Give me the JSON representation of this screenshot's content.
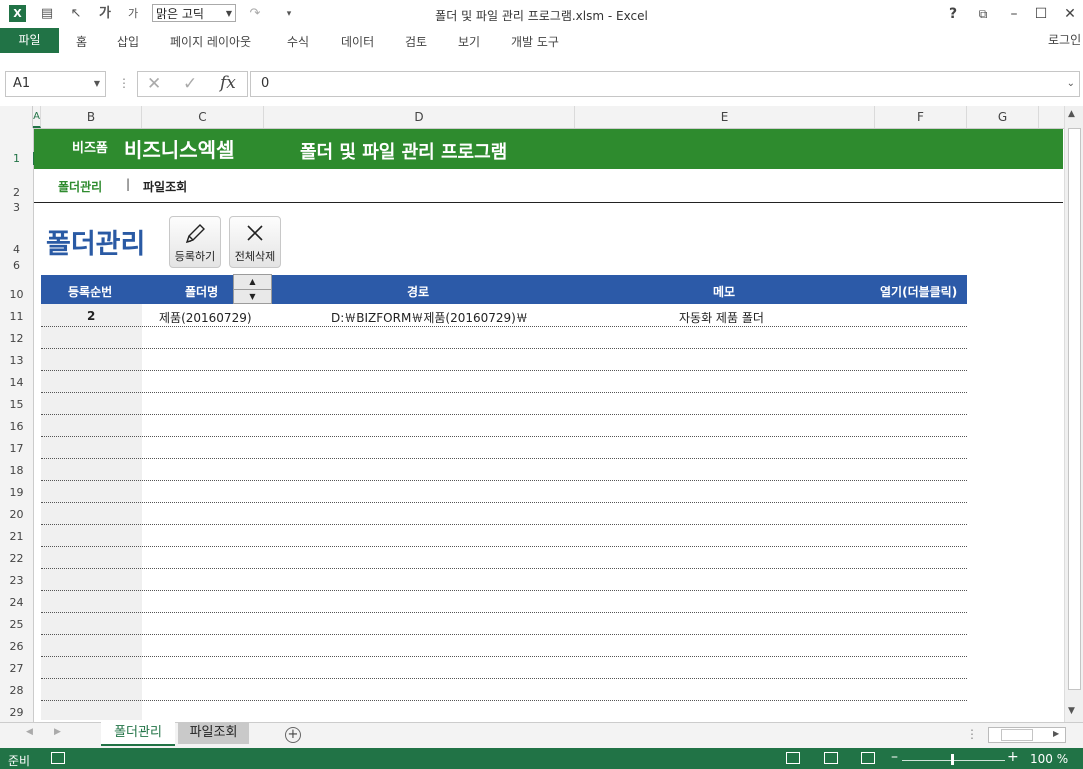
{
  "window": {
    "title": "폴더 및 파일 관리 프로그램.xlsm - Excel",
    "font_name": "맑은 고딕",
    "login": "로그인",
    "help": "?"
  },
  "ribbon": {
    "file": "파일",
    "tabs": [
      "홈",
      "삽입",
      "페이지 레이아웃",
      "수식",
      "데이터",
      "검토",
      "보기",
      "개발 도구"
    ]
  },
  "formula_bar": {
    "name_box": "A1",
    "fx": "fx",
    "value": "0"
  },
  "columns": [
    "A",
    "B",
    "C",
    "D",
    "E",
    "F",
    "G"
  ],
  "rows": [
    "1",
    "2",
    "3",
    "4",
    "6",
    "10",
    "11",
    "12",
    "13",
    "14",
    "15",
    "16",
    "17",
    "18",
    "19",
    "20",
    "21",
    "22",
    "23",
    "24",
    "25",
    "26",
    "27",
    "28",
    "29"
  ],
  "sheet": {
    "brand_small": "비즈폼",
    "brand_big": "비즈니스엑셀",
    "program_title": "폴더 및  파일 관리 프로그램",
    "nav": {
      "folder": "폴더관리",
      "separator": "|",
      "file": "파일조회"
    },
    "heading": "폴더관리",
    "buttons": {
      "register": "등록하기",
      "delete_all": "전체삭제"
    },
    "table": {
      "headers": [
        "등록순번",
        "폴더명",
        "경로",
        "메모",
        "열기(더블클릭)"
      ],
      "rows": [
        {
          "num": "2",
          "name": "제품(20160729)",
          "path": "D:￦BIZFORM￦제품(20160729)￦",
          "memo": "자동화 제품 폴더"
        }
      ]
    }
  },
  "sheet_tabs": [
    "폴더관리",
    "파일조회"
  ],
  "status": {
    "ready": "준비",
    "zoom": "100 %"
  },
  "colors": {
    "excel_green": "#217346",
    "banner_green": "#2e8b2e",
    "header_blue": "#2c5aa8",
    "heading_blue": "#2a5aa4"
  }
}
